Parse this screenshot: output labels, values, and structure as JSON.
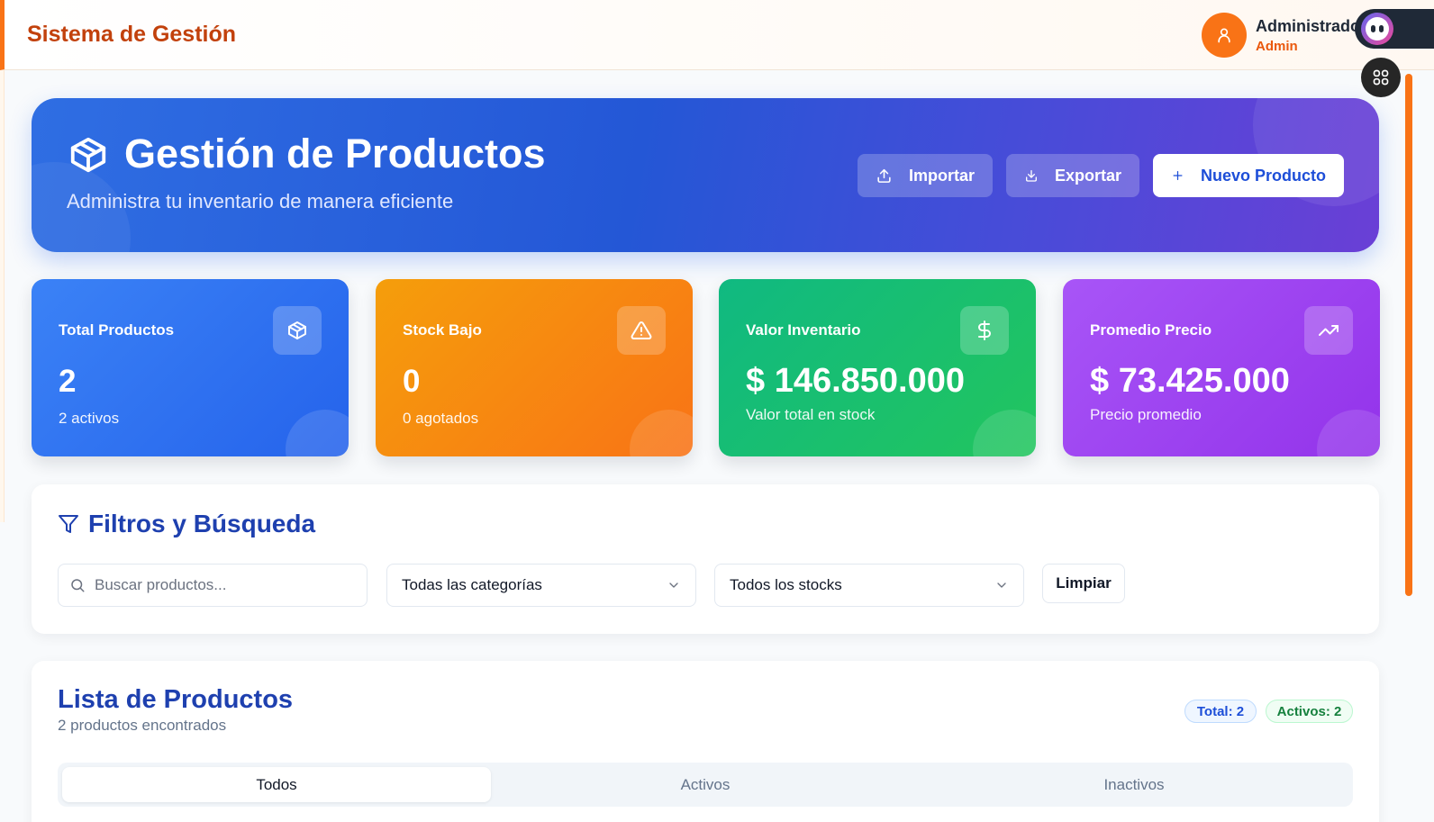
{
  "header": {
    "brand": "Sistema de Gestión",
    "user_name": "Administrado",
    "user_role": "Admin",
    "icons": [
      "user-icon",
      "extension-face-icon",
      "grid-icon"
    ]
  },
  "hero": {
    "title": "Gestión de Productos",
    "subtitle": "Administra tu inventario de manera eficiente",
    "buttons": {
      "import": "Importar",
      "export": "Exportar",
      "new": "Nuevo Producto"
    }
  },
  "stats": [
    {
      "label": "Total Productos",
      "value": "2",
      "note": "2 activos",
      "icon": "box-icon",
      "color": "#2563eb"
    },
    {
      "label": "Stock Bajo",
      "value": "0",
      "note": "0 agotados",
      "icon": "alert-triangle-icon",
      "color": "#f97316"
    },
    {
      "label": "Valor Inventario",
      "value": "$ 146.850.000",
      "note": "Valor total en stock",
      "icon": "dollar-icon",
      "color": "#22c55e"
    },
    {
      "label": "Promedio Precio",
      "value": "$ 73.425.000",
      "note": "Precio promedio",
      "icon": "trending-up-icon",
      "color": "#9333ea"
    }
  ],
  "filters": {
    "title": "Filtros y Búsqueda",
    "search_placeholder": "Buscar productos...",
    "search_value": "",
    "category_selected": "Todas las categorías",
    "stock_selected": "Todos los stocks",
    "clear_label": "Limpiar"
  },
  "list": {
    "title": "Lista de Productos",
    "subtitle": "2 productos encontrados",
    "badge_total": "Total: 2",
    "badge_active": "Activos: 2",
    "tabs": [
      "Todos",
      "Activos",
      "Inactivos"
    ],
    "active_tab": "Todos"
  },
  "colors": {
    "accent": "#f97316",
    "primary": "#1e40af"
  }
}
